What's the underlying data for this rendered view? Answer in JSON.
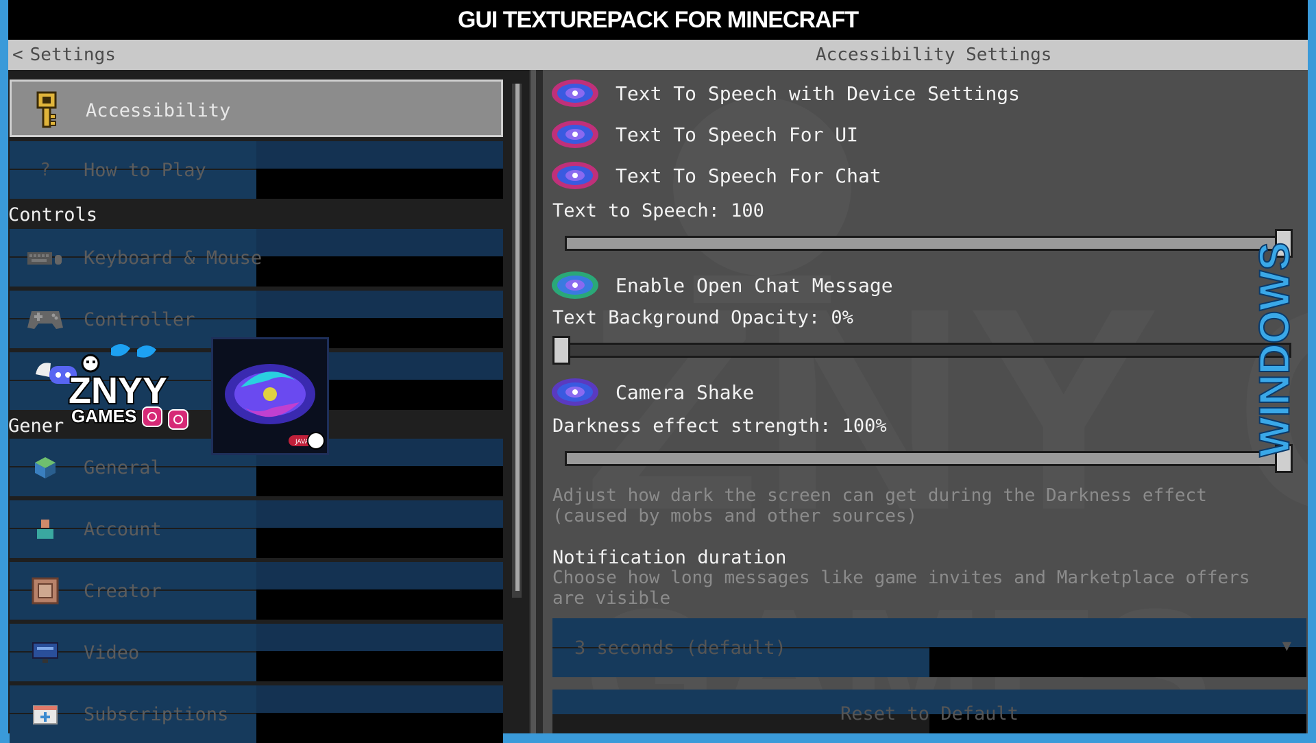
{
  "title_bar": {
    "text": "GUI TEXTUREPACK FOR MINECRAFT"
  },
  "header": {
    "back_icon": "chevron-left-icon",
    "back_label": "Settings",
    "page_title": "Accessibility Settings"
  },
  "sidebar": {
    "top_items": [
      {
        "label": "Accessibility",
        "icon": "key-icon",
        "active": true
      },
      {
        "label": "How to Play",
        "icon": "question-icon",
        "active": false
      }
    ],
    "controls_heading": "Controls",
    "controls_items": [
      {
        "label": "Keyboard & Mouse",
        "icon": "keyboard-icon"
      },
      {
        "label": "Controller",
        "icon": "gamepad-icon"
      }
    ],
    "general_heading": "Gener",
    "general_items": [
      {
        "label": "General",
        "icon": "cube-icon"
      },
      {
        "label": "Account",
        "icon": "account-icon"
      },
      {
        "label": "Creator",
        "icon": "command-block-icon"
      },
      {
        "label": "Video",
        "icon": "monitor-icon"
      },
      {
        "label": "Subscriptions",
        "icon": "subscriptions-icon"
      }
    ]
  },
  "content": {
    "toggles": [
      {
        "label": "Text To Speech with Device Settings",
        "icon": "galaxy-toggle-icon"
      },
      {
        "label": "Text To Speech For UI",
        "icon": "galaxy-toggle-icon"
      },
      {
        "label": "Text To Speech For Chat",
        "icon": "galaxy-toggle-icon"
      }
    ],
    "tts_slider": {
      "label": "Text to Speech: 100",
      "value": 1.0
    },
    "open_chat_toggle": {
      "label": "Enable Open Chat Message",
      "icon": "galaxy-toggle-on-icon"
    },
    "bg_opacity_slider": {
      "label": "Text Background Opacity: 0%",
      "value": 0.0
    },
    "camera_shake_toggle": {
      "label": "Camera Shake",
      "icon": "galaxy-toggle-icon"
    },
    "darkness_slider": {
      "label": "Darkness effect strength: 100%",
      "value": 1.0
    },
    "darkness_desc": "Adjust how dark the screen can get during the Darkness effect (caused by mobs and other sources)",
    "notification_heading": "Notification duration",
    "notification_desc": "Choose how long messages like game invites and Marketplace offers are visible",
    "dropdown_value": "3 seconds (default)",
    "reset_label": "Reset to Default"
  },
  "branding": {
    "logo_text": "ZNYY",
    "logo_subtext": "GAMES",
    "badge_text": "JAVA",
    "side_text": "WINDOWS",
    "watermark_text": "ZNY GAMES"
  },
  "colors": {
    "frame": "#3a9ad9",
    "stripe": "#163a5c",
    "panel": "#4e4e4e",
    "active": "#8c8c8c"
  }
}
